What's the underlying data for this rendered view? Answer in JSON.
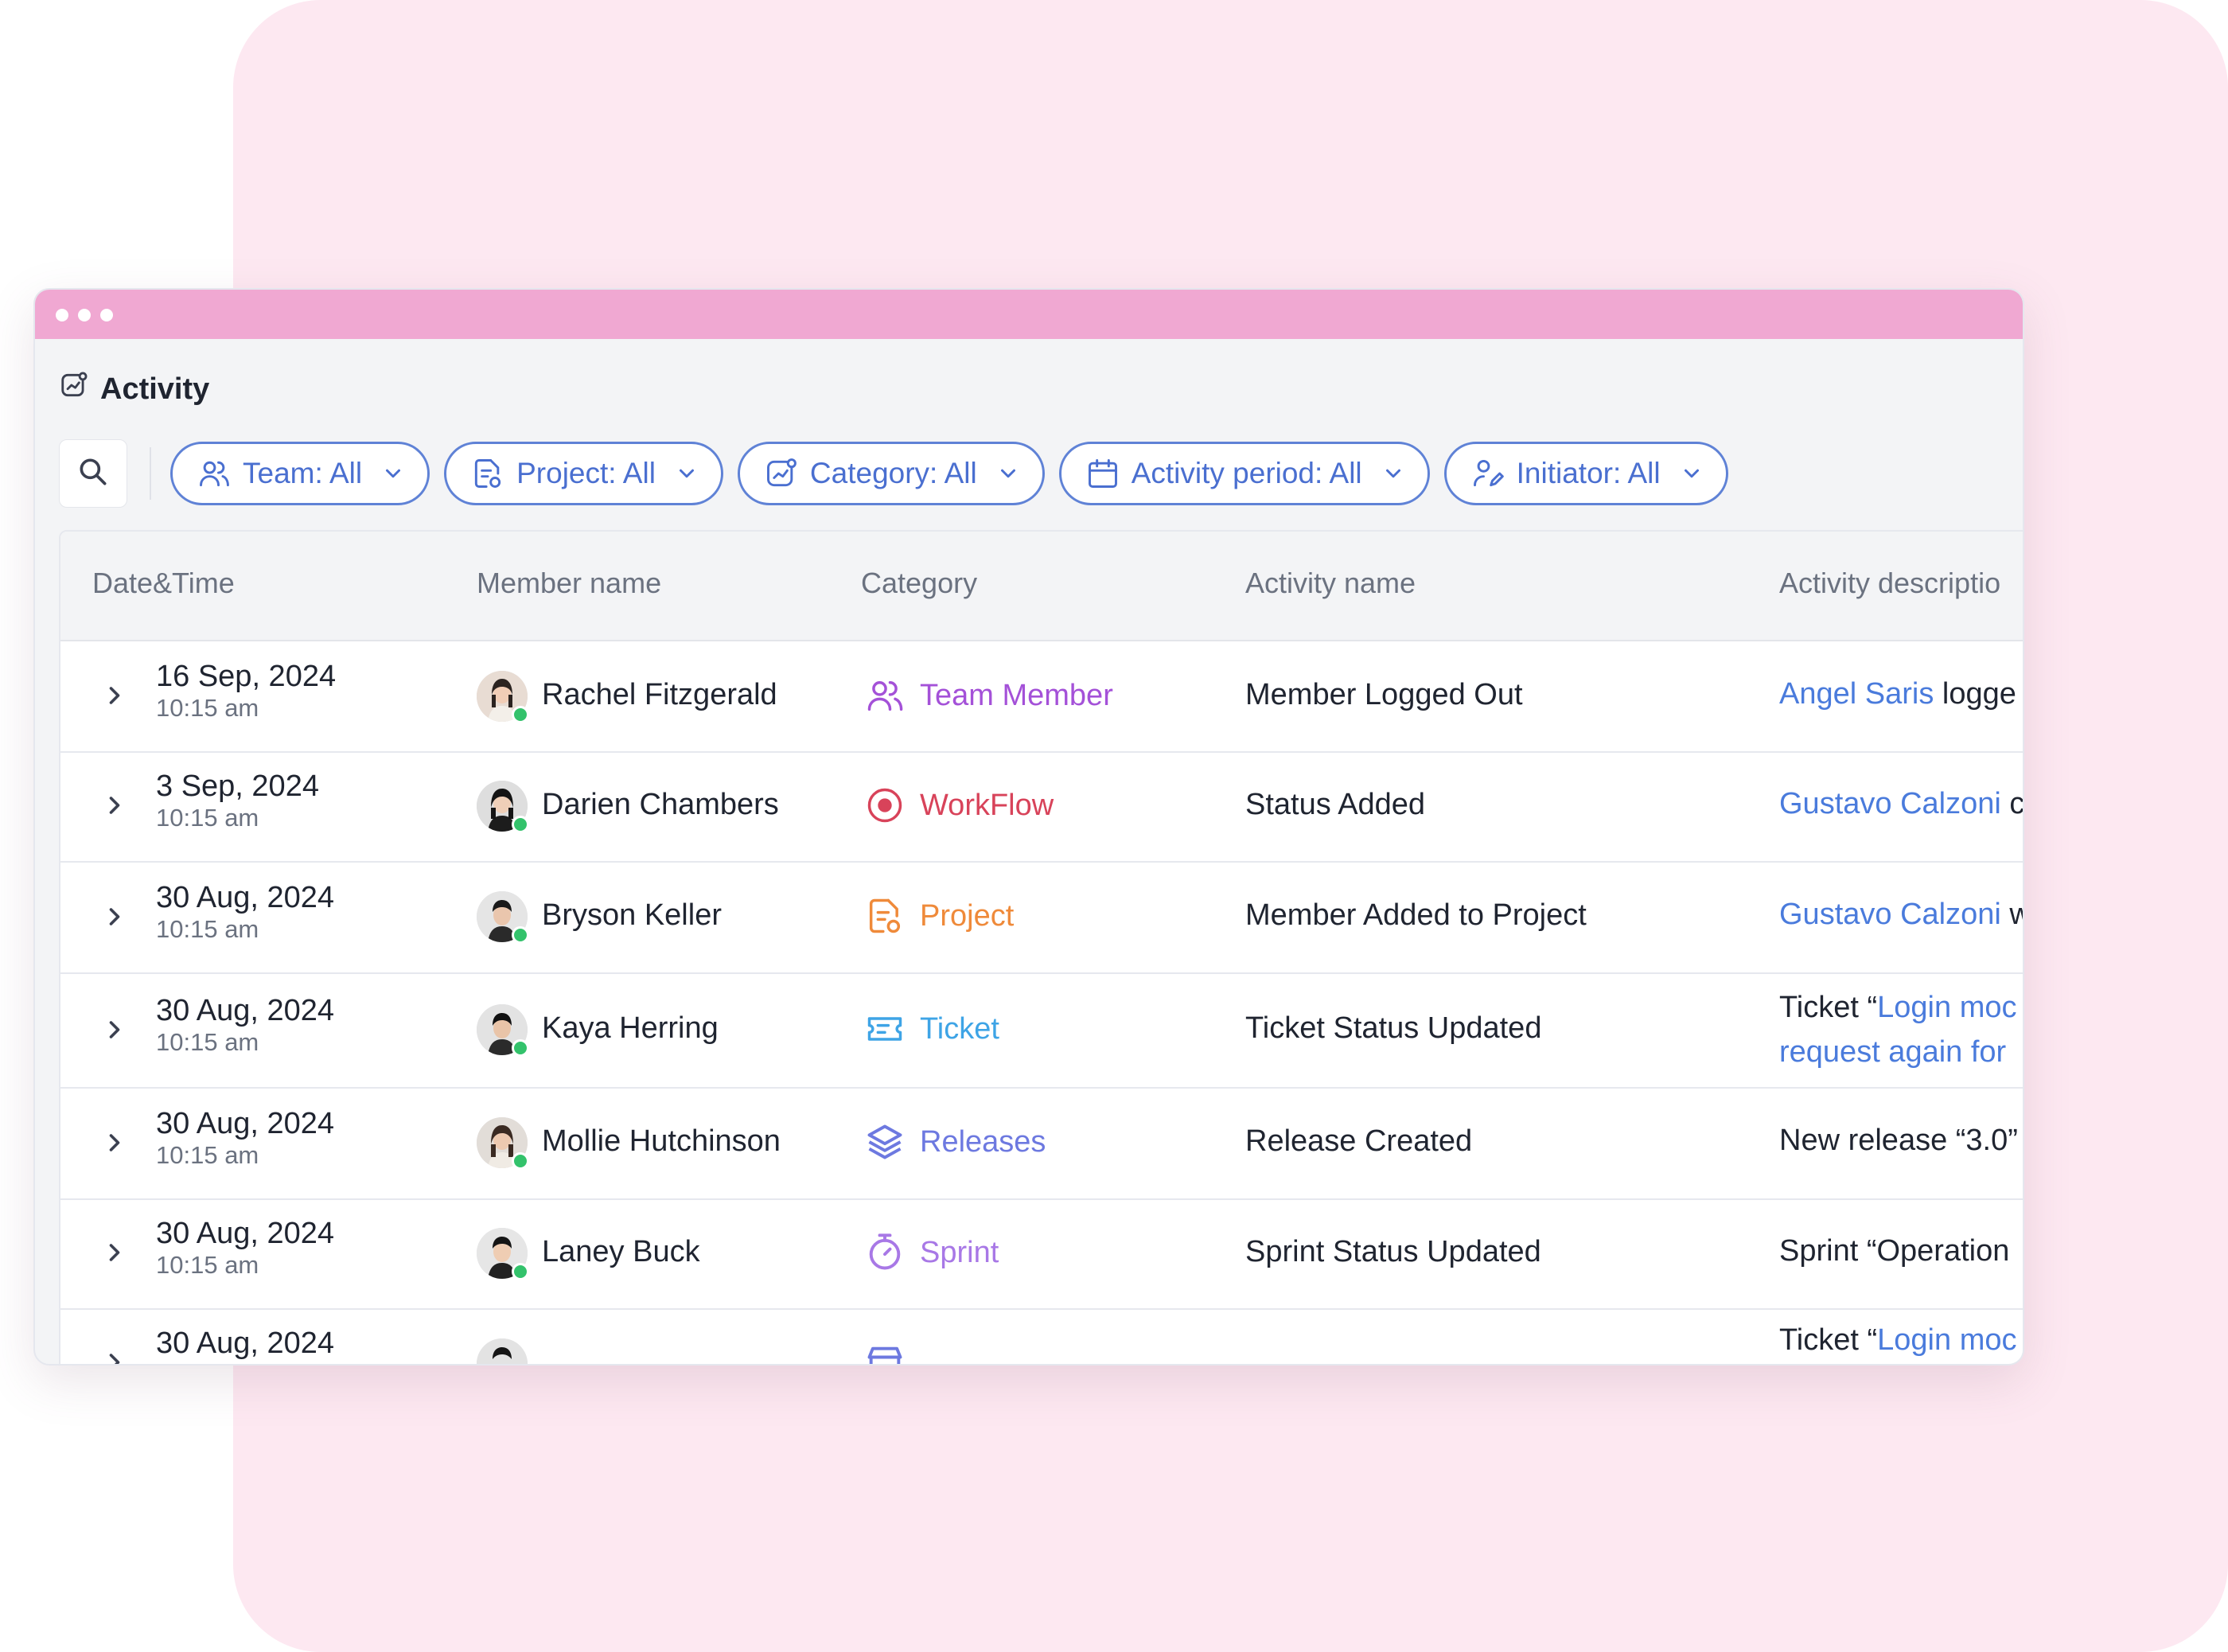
{
  "window": {
    "title": "Activity"
  },
  "filters": {
    "team": "Team: All",
    "project": "Project: All",
    "category": "Category: All",
    "activity_period": "Activity period: All",
    "initiator": "Initiator: All"
  },
  "table": {
    "headers": [
      "Date&Time",
      "Member name",
      "Category",
      "Activity name",
      "Activity descriptio"
    ],
    "rows": [
      {
        "date": "16 Sep, 2024",
        "time": "10:15 am",
        "member": "Rachel Fitzgerald",
        "category": "Team Member",
        "activity": "Member Logged Out",
        "desc_link": "Angel Saris",
        "desc_text": " logge"
      },
      {
        "date": "3 Sep, 2024",
        "time": "10:15 am",
        "member": "Darien Chambers",
        "category": "WorkFlow",
        "activity": "Status Added",
        "desc_link": "Gustavo Calzoni",
        "desc_text": " c"
      },
      {
        "date": "30 Aug, 2024",
        "time": "10:15 am",
        "member": "Bryson Keller",
        "category": "Project",
        "activity": "Member Added to Project",
        "desc_link": "Gustavo Calzoni",
        "desc_text": " w"
      },
      {
        "date": "30 Aug, 2024",
        "time": "10:15 am",
        "member": "Kaya Herring",
        "category": "Ticket",
        "activity": "Ticket Status Updated",
        "desc_text": "Ticket “",
        "desc_link": "Login moc",
        "desc_line2": "request again for"
      },
      {
        "date": "30 Aug, 2024",
        "time": "10:15 am",
        "member": "Mollie Hutchinson",
        "category": "Releases",
        "activity": "Release Created",
        "desc_text": "New release “3.0”"
      },
      {
        "date": "30 Aug, 2024",
        "time": "10:15 am",
        "member": "Laney Buck",
        "category": "Sprint",
        "activity": "Sprint Status Updated",
        "desc_text": "Sprint “Operation"
      },
      {
        "date": "30 Aug, 2024",
        "desc_text": "Ticket “",
        "desc_link": "Login moc"
      }
    ]
  },
  "colors": {
    "accent": "#4a6fd0",
    "titlebar": "#f0a8d2",
    "background_panel": "#fde8f1",
    "team_member": "#a451d8",
    "workflow": "#d8435a",
    "project": "#ef8a3a",
    "ticket": "#3ea4e6",
    "releases": "#6d79e0",
    "sprint": "#a878e6"
  }
}
